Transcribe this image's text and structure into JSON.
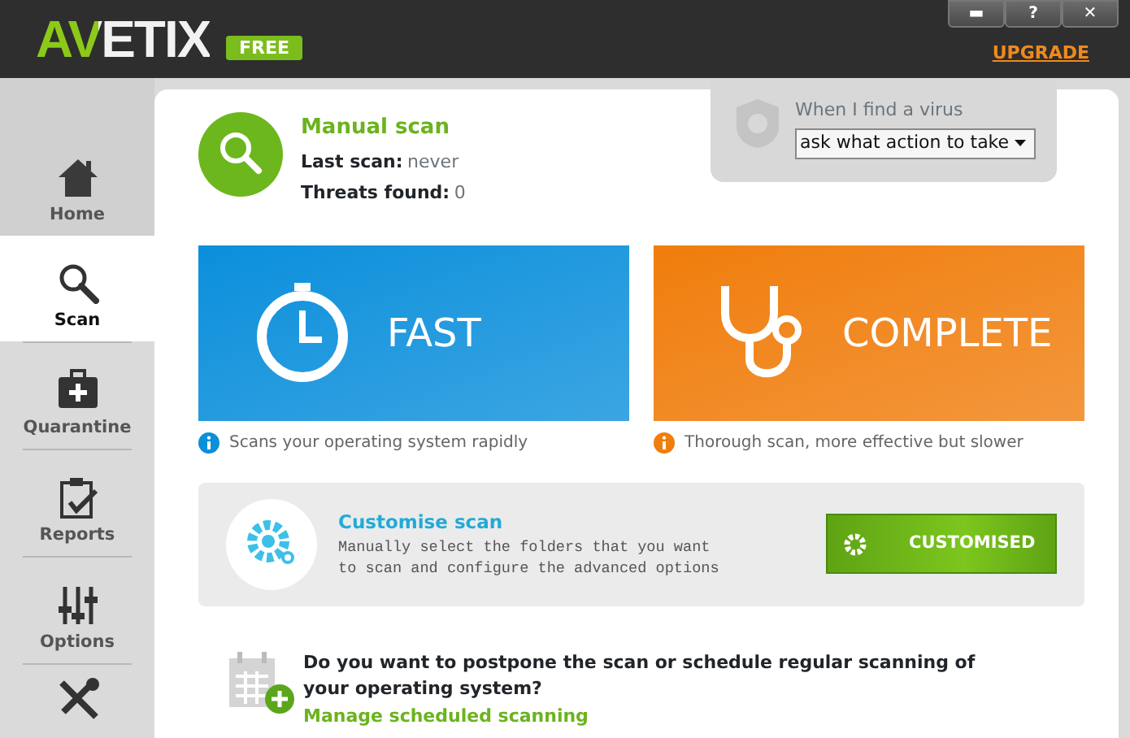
{
  "header": {
    "logo": "AVETIX",
    "edition": "FREE",
    "window_buttons": [
      "▬",
      "?",
      "✕"
    ],
    "upgrade": "UPGRADE"
  },
  "sidebar": {
    "items": [
      {
        "label": "Home",
        "selected": false
      },
      {
        "label": "Scan",
        "selected": true
      },
      {
        "label": "Quarantine",
        "selected": false
      },
      {
        "label": "Reports",
        "selected": false
      },
      {
        "label": "Options",
        "selected": false
      },
      {
        "selected": false
      }
    ]
  },
  "scan_header": {
    "title": "Manual scan",
    "last_scan_label": "Last scan:",
    "last_scan": "never",
    "threats_label": "Threats found:",
    "threats": "0"
  },
  "virus_action": {
    "label": "When I find a virus",
    "value": "ask what action to take"
  },
  "scan_modes": [
    {
      "kind": "fast",
      "label": "FAST",
      "color": "#0b8fdb",
      "description": "Scans your operating system rapidly"
    },
    {
      "kind": "complete",
      "label": "COMPLETE",
      "color": "#f07d0c",
      "description": "Thorough scan, more effective but slower"
    }
  ],
  "custom": {
    "title": "Customise scan",
    "description": "Manually select the folders that you want to scan and configure the advanced options",
    "button": "CUSTOMISED"
  },
  "schedule": {
    "question": "Do you want to postpone the scan or schedule regular scanning of your operating system?",
    "link": "Manage scheduled scanning"
  }
}
